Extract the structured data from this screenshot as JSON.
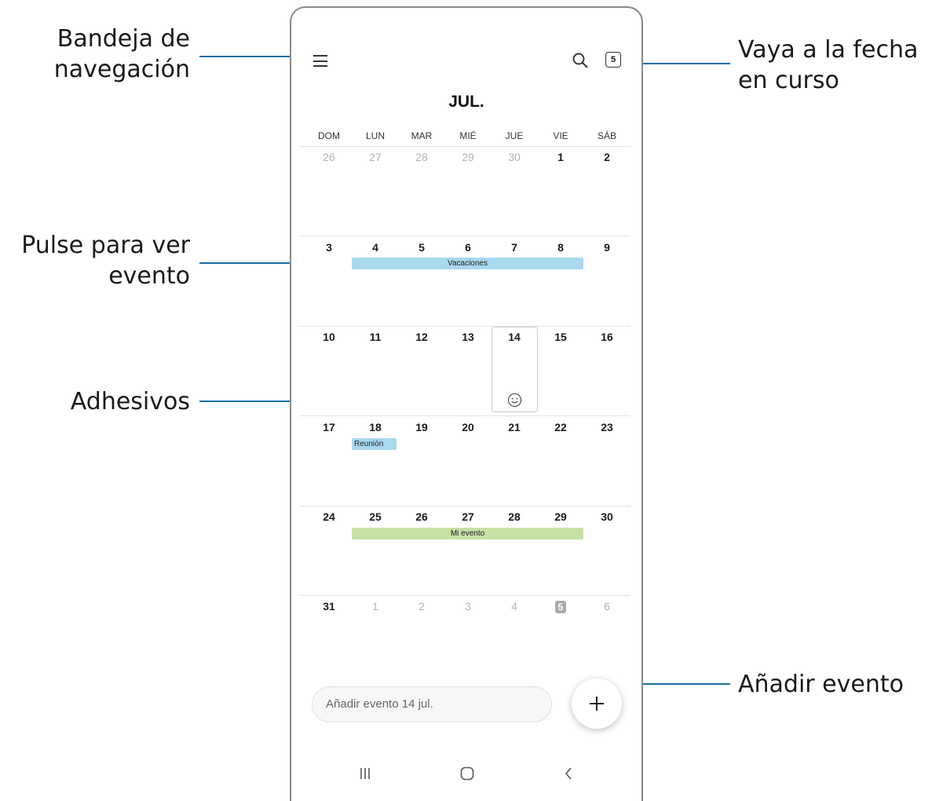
{
  "callouts": {
    "nav_drawer_line1": "Bandeja de",
    "nav_drawer_line2": "navegación",
    "tap_event_line1": "Pulse para ver",
    "tap_event_line2": "evento",
    "stickers": "Adhesivos",
    "go_today_line1": "Vaya a la fecha",
    "go_today_line2": "en curso",
    "add_event": "Añadir evento"
  },
  "header": {
    "menu_icon": "hamburger-menu-icon",
    "search_icon": "search-icon",
    "today_number": "5",
    "month": "JUL."
  },
  "weekdays": [
    "DOM",
    "LUN",
    "MAR",
    "MIÉ",
    "JUE",
    "VIE",
    "SÁB"
  ],
  "weeks": [
    [
      "26",
      "27",
      "28",
      "29",
      "30",
      "1",
      "2"
    ],
    [
      "3",
      "4",
      "5",
      "6",
      "7",
      "8",
      "9"
    ],
    [
      "10",
      "11",
      "12",
      "13",
      "14",
      "15",
      "16"
    ],
    [
      "17",
      "18",
      "19",
      "20",
      "21",
      "22",
      "23"
    ],
    [
      "24",
      "25",
      "26",
      "27",
      "28",
      "29",
      "30"
    ],
    [
      "31",
      "1",
      "2",
      "3",
      "4",
      "5",
      "6"
    ]
  ],
  "events": {
    "vacaciones": "Vacaciones",
    "reunion": "Reunión",
    "mi_evento": "Mi evento"
  },
  "colors": {
    "accent_line": "#1d6fa3",
    "event_blue": "#a9d8ef",
    "event_green": "#c6e0a5"
  },
  "sticker_icon": "smiley-sticker-icon",
  "bottom": {
    "add_placeholder": "Añadir evento 14 jul.",
    "fab_icon": "plus-icon"
  },
  "navbar": {
    "recents_icon": "recents-icon",
    "home_icon": "home-icon",
    "back_icon": "back-icon"
  }
}
